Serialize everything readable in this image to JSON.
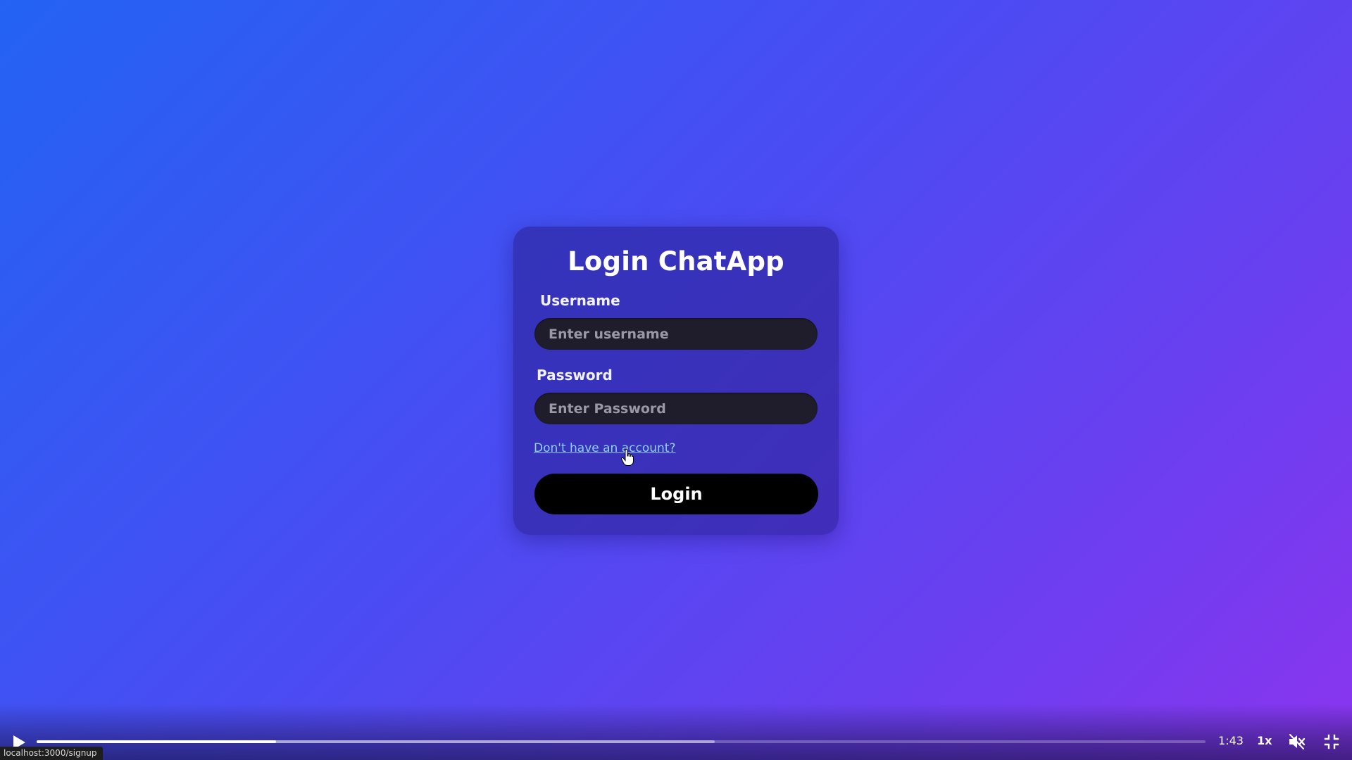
{
  "colors": {
    "background_start": "#2363f3",
    "background_end": "#8a35ee",
    "card_bg": "#3a2a9a",
    "input_bg": "#1f1c2b",
    "button_bg": "#000000",
    "link": "#8fd0ff"
  },
  "login_card": {
    "title": "Login ChatApp",
    "username_label": "Username",
    "username_placeholder": "Enter username",
    "password_label": "Password",
    "password_placeholder": "Enter Password",
    "signup_link": "Don't have an account?",
    "login_button": "Login"
  },
  "player": {
    "play_icon": "play-icon",
    "progress_played_fraction": 0.205,
    "progress_buffered_fraction": 0.58,
    "time": "1:43",
    "speed": "1x",
    "mute_icon": "volume-muted-icon",
    "fullscreen_icon": "exit-fullscreen-icon"
  },
  "status_bar": {
    "url": "localhost:3000/signup"
  }
}
